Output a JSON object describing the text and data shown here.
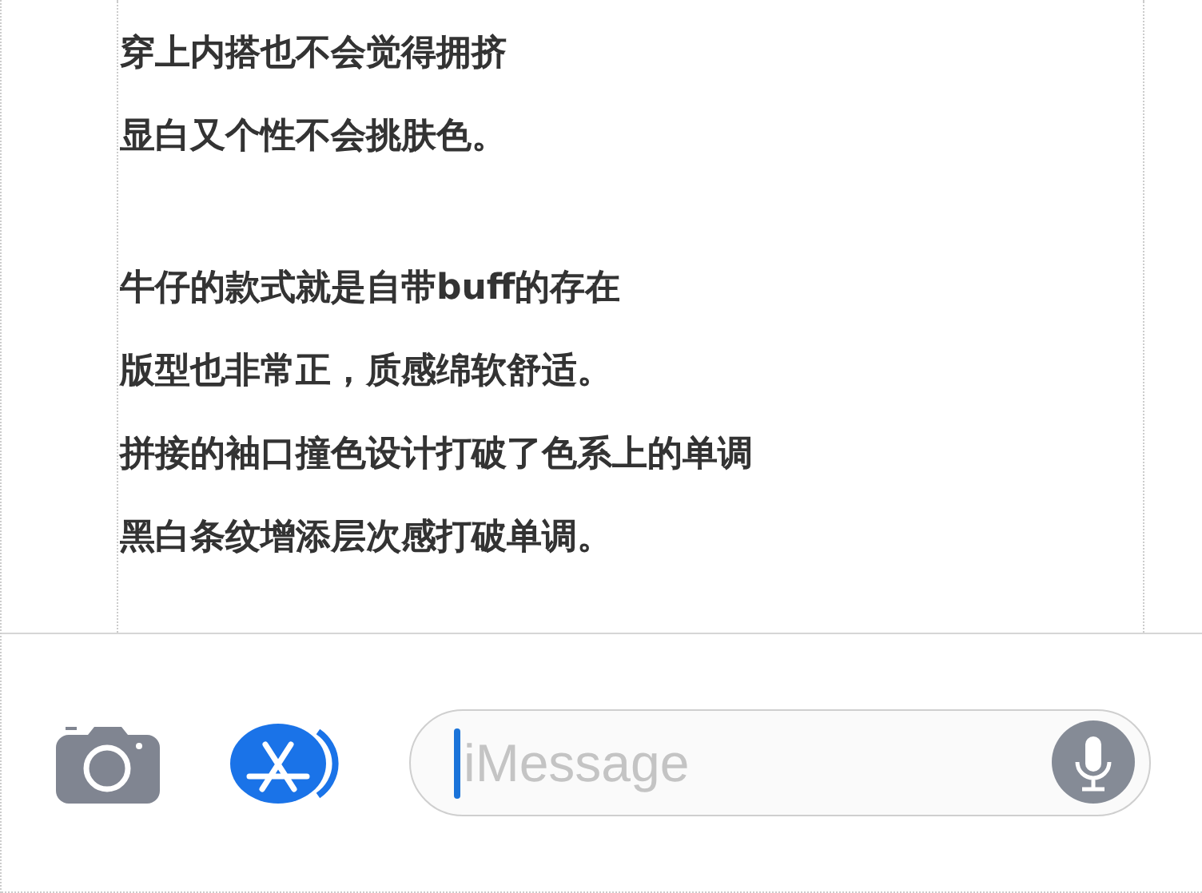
{
  "paragraphs": [
    {
      "lines": [
        "穿上内搭也不会觉得拥挤",
        "显白又个性不会挑肤色。"
      ]
    },
    {
      "lines": [
        "牛仔的款式就是自带buff的存在",
        "版型也非常正，质感绵软舒适。",
        "拼接的袖口撞色设计打破了色系上的单调",
        "黑白条纹增添层次感打破单调。"
      ]
    }
  ],
  "composer": {
    "placeholder": "iMessage"
  }
}
